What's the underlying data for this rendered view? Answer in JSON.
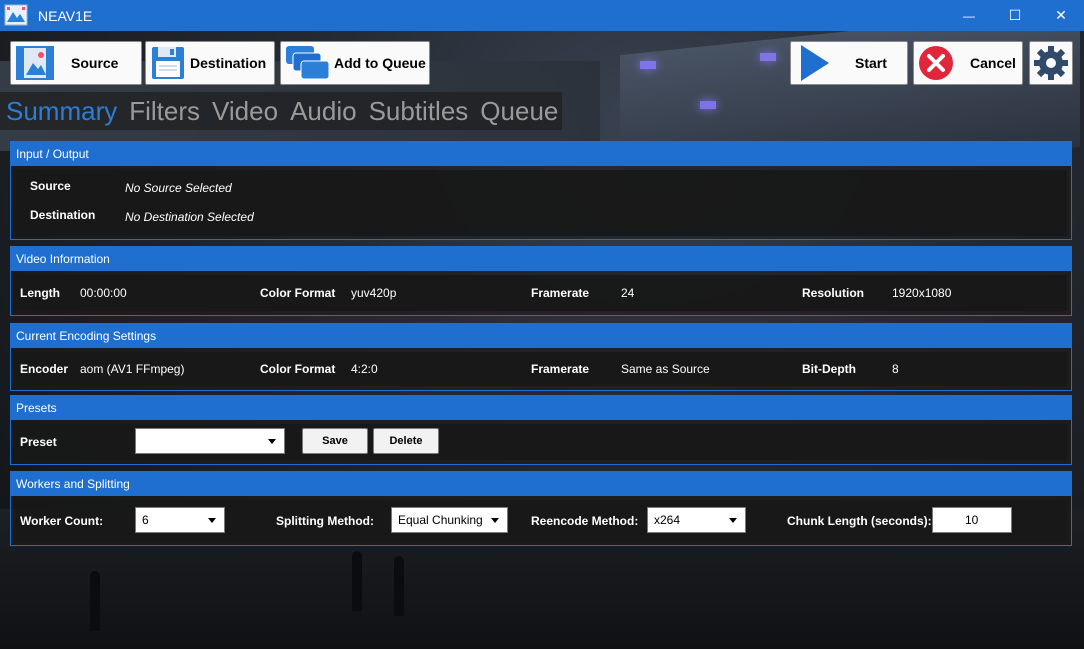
{
  "window": {
    "title": "NEAV1E"
  },
  "window_controls": {
    "minimize": "—",
    "maximize": "☐",
    "close": "✕"
  },
  "toolbar": {
    "source_label": "Source",
    "destination_label": "Destination",
    "add_to_queue_label": "Add to Queue",
    "start_label": "Start",
    "cancel_label": "Cancel"
  },
  "tabs": [
    "Summary",
    "Filters",
    "Video",
    "Audio",
    "Subtitles",
    "Queue"
  ],
  "active_tab": "Summary",
  "input_output": {
    "header": "Input / Output",
    "source_label": "Source",
    "source_value": "No Source Selected",
    "destination_label": "Destination",
    "destination_value": "No Destination Selected"
  },
  "video_info": {
    "header": "Video Information",
    "length_label": "Length",
    "length_value": "00:00:00",
    "color_format_label": "Color Format",
    "color_format_value": "yuv420p",
    "framerate_label": "Framerate",
    "framerate_value": "24",
    "resolution_label": "Resolution",
    "resolution_value": "1920x1080"
  },
  "encoding": {
    "header": "Current Encoding Settings",
    "encoder_label": "Encoder",
    "encoder_value": "aom (AV1 FFmpeg)",
    "color_format_label": "Color Format",
    "color_format_value": "4:2:0",
    "framerate_label": "Framerate",
    "framerate_value": "Same as Source",
    "bit_depth_label": "Bit-Depth",
    "bit_depth_value": "8"
  },
  "presets": {
    "header": "Presets",
    "preset_label": "Preset",
    "preset_value": "",
    "save_label": "Save",
    "delete_label": "Delete"
  },
  "workers": {
    "header": "Workers and Splitting",
    "worker_count_label": "Worker Count:",
    "worker_count_value": "6",
    "splitting_label": "Splitting Method:",
    "splitting_value": "Equal Chunking",
    "reencode_label": "Reencode Method:",
    "reencode_value": "x264",
    "chunk_length_label": "Chunk Length (seconds):",
    "chunk_length_value": "10"
  },
  "colors": {
    "accent": "#1e6fcf",
    "active_tab": "#2b7fd6",
    "inactive_tab": "#9a9a9a",
    "cancel_red": "#e0263a"
  }
}
